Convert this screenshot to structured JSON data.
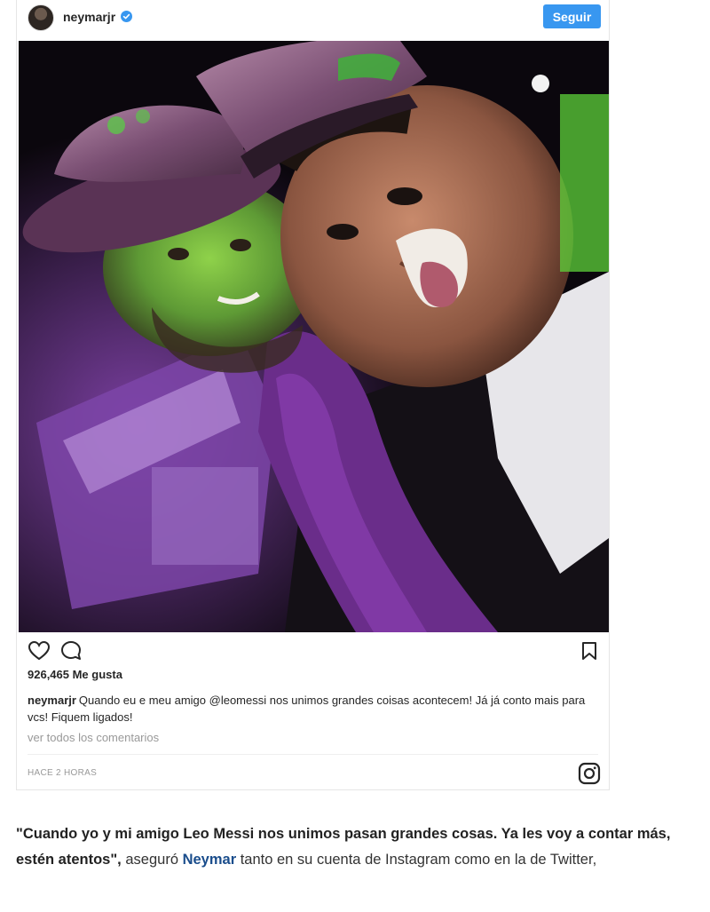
{
  "post": {
    "username": "neymarjr",
    "follow_label": "Seguir",
    "likes": "926,465 Me gusta",
    "caption": {
      "user": "neymarjr",
      "text": "Quando eu e meu amigo @leomessi nos unimos grandes coisas acontecem! Já já conto mais para vcs! Fiquem ligados!"
    },
    "view_comments": "ver todos los comentarios",
    "timestamp": "HACE 2 HORAS"
  },
  "icons": {
    "verified": "verified-badge-icon",
    "like": "heart-icon",
    "comment": "comment-icon",
    "save": "bookmark-icon",
    "instagram": "instagram-logo-icon"
  },
  "colors": {
    "follow_button": "#3897f0",
    "verified_badge": "#3897f0",
    "link": "#1a4d8c"
  },
  "article": {
    "quote": "\"Cuando yo y mi amigo Leo Messi nos unimos pasan grandes cosas. Ya les voy a contar más, estén atentos\",",
    "text_before_name": " aseguró ",
    "name": "Neymar",
    "text_after_name": " tanto en su cuenta de Instagram como en la de Twitter,"
  }
}
